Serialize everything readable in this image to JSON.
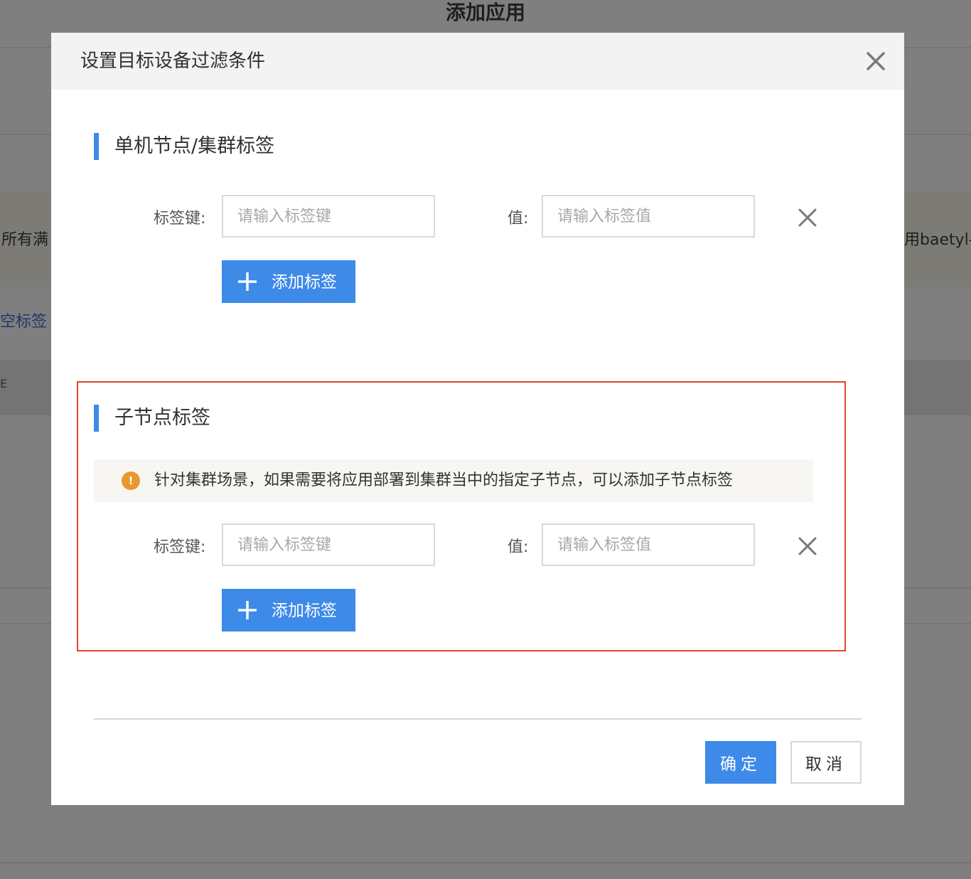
{
  "background": {
    "page_title": "添加应用",
    "left_text": "所有满",
    "right_text": "用baetyl-",
    "link_text": "空标签",
    "small_text": "E"
  },
  "modal": {
    "title": "设置目标设备过滤条件",
    "close_icon": "close-icon",
    "node_section": {
      "title": "单机节点/集群标签",
      "key_label": "标签键:",
      "key_placeholder": "请输入标签键",
      "value_label": "值:",
      "value_placeholder": "请输入标签值",
      "add_button_label": "添加标签"
    },
    "subnode_section": {
      "title": "子节点标签",
      "notice_text": "针对集群场景，如果需要将应用部署到集群当中的指定子节点，可以添加子节点标签",
      "key_label": "标签键:",
      "key_placeholder": "请输入标签键",
      "value_label": "值:",
      "value_placeholder": "请输入标签值",
      "add_button_label": "添加标签"
    },
    "footer": {
      "ok_label": "确定",
      "cancel_label": "取消"
    }
  },
  "colors": {
    "primary": "#3d8ae8",
    "highlight_border": "#e0442c",
    "notice_icon": "#e8972f",
    "overlay": "#7f7f7f"
  }
}
